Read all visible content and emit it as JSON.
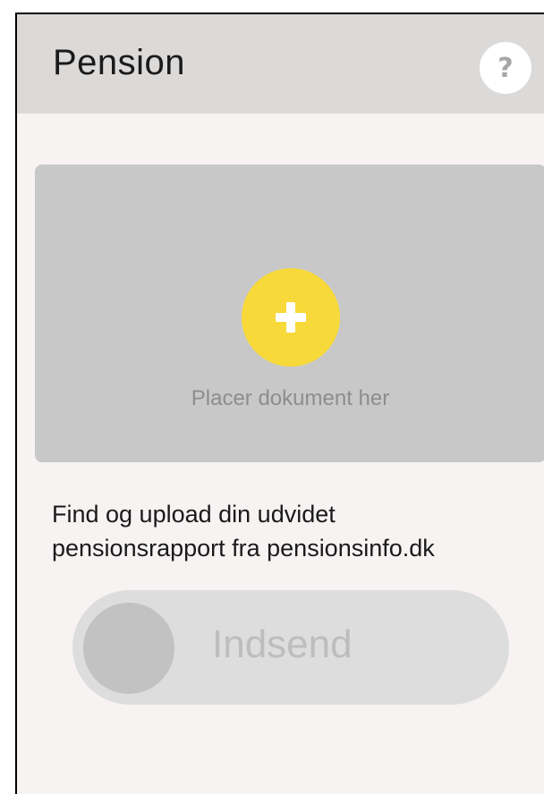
{
  "header": {
    "title": "Pension",
    "help_label": "?"
  },
  "dropzone": {
    "label": "Placer dokument her",
    "plus_symbol": "+",
    "accent_color": "#f7da3a"
  },
  "instructions": {
    "lines": [
      "Find og upload din udvidet",
      "pensionsrapport fra pensionsinfo.dk"
    ]
  },
  "send_slider": {
    "label": "Indsend",
    "enabled": false
  },
  "icons": {
    "help": "question-mark-icon",
    "add": "plus-icon"
  }
}
